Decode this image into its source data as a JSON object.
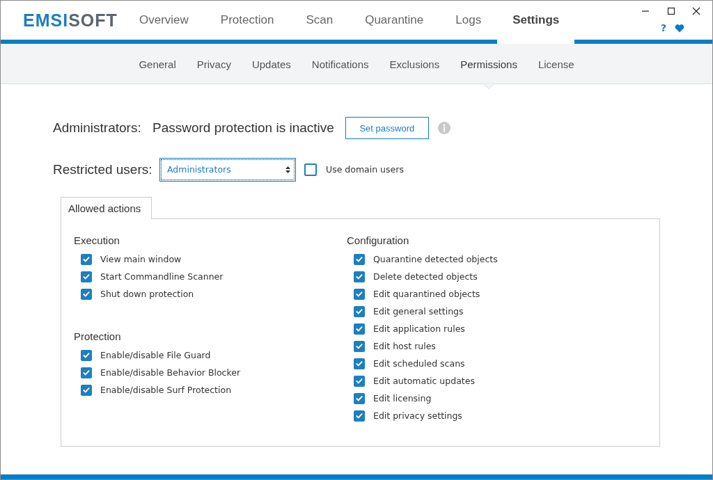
{
  "logo": [
    "EMSI",
    "SOFT"
  ],
  "tabs": [
    {
      "label": "Overview",
      "selected": false
    },
    {
      "label": "Protection",
      "selected": false
    },
    {
      "label": "Scan",
      "selected": false
    },
    {
      "label": "Quarantine",
      "selected": false
    },
    {
      "label": "Logs",
      "selected": false
    },
    {
      "label": "Settings",
      "selected": true
    }
  ],
  "help": "?",
  "subtabs": [
    {
      "label": "General",
      "selected": false
    },
    {
      "label": "Privacy",
      "selected": false
    },
    {
      "label": "Updates",
      "selected": false
    },
    {
      "label": "Notifications",
      "selected": false
    },
    {
      "label": "Exclusions",
      "selected": false
    },
    {
      "label": "Permissions",
      "selected": true
    },
    {
      "label": "License",
      "selected": false
    }
  ],
  "administrators": {
    "label": "Administrators:",
    "status": "Password protection is inactive",
    "button": "Set password"
  },
  "restricted": {
    "label": "Restricted users:",
    "value": "Administrators",
    "domain_label": "Use domain users",
    "domain_checked": false
  },
  "panel_tab": "Allowed actions",
  "columns": [
    [
      {
        "title": "Execution",
        "items": [
          {
            "label": "View main window",
            "checked": true
          },
          {
            "label": "Start Commandline Scanner",
            "checked": true
          },
          {
            "label": "Shut down protection",
            "checked": true
          }
        ]
      },
      {
        "title": "Protection",
        "items": [
          {
            "label": "Enable/disable File Guard",
            "checked": true
          },
          {
            "label": "Enable/disable Behavior Blocker",
            "checked": true
          },
          {
            "label": "Enable/disable Surf Protection",
            "checked": true
          }
        ]
      }
    ],
    [
      {
        "title": "Configuration",
        "items": [
          {
            "label": "Quarantine detected objects",
            "checked": true
          },
          {
            "label": "Delete detected objects",
            "checked": true
          },
          {
            "label": "Edit quarantined objects",
            "checked": true
          },
          {
            "label": "Edit general settings",
            "checked": true
          },
          {
            "label": "Edit application rules",
            "checked": true
          },
          {
            "label": "Edit host rules",
            "checked": true
          },
          {
            "label": "Edit scheduled scans",
            "checked": true
          },
          {
            "label": "Edit automatic updates",
            "checked": true
          },
          {
            "label": "Edit licensing",
            "checked": true
          },
          {
            "label": "Edit privacy settings",
            "checked": true
          }
        ]
      }
    ]
  ]
}
